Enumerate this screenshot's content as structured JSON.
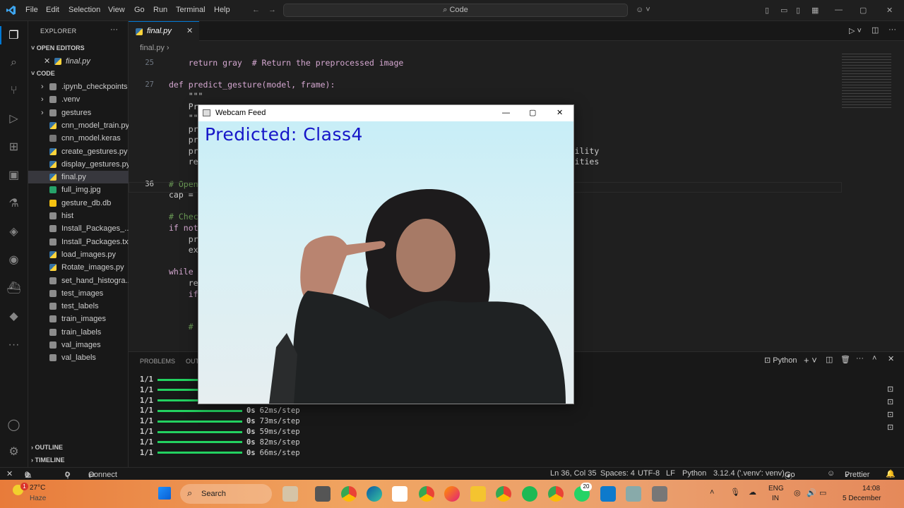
{
  "titlebar": {
    "menu": [
      "File",
      "Edit",
      "Selection",
      "View",
      "Go",
      "Run",
      "Terminal",
      "Help"
    ],
    "search": "Code"
  },
  "sidebar": {
    "title": "EXPLORER",
    "open_editors": "OPEN EDITORS",
    "open_file": "final.py",
    "folder": "CODE",
    "files": [
      ".ipynb_checkpoints",
      ".venv",
      "gestures",
      "cnn_model_train.py",
      "cnn_model.keras",
      "create_gestures.py",
      "display_gestures.py",
      "final.py",
      "full_img.jpg",
      "gesture_db.db",
      "hist",
      "Install_Packages_...",
      "Install_Packages.txt",
      "load_images.py",
      "Rotate_images.py",
      "set_hand_histogra...",
      "test_images",
      "test_labels",
      "train_images",
      "train_labels",
      "val_images",
      "val_labels"
    ],
    "outline": "OUTLINE",
    "timeline": "TIMELINE"
  },
  "editor": {
    "tab": "final.py",
    "breadcrumb": "final.py",
    "lines": [
      {
        "n": "25",
        "t": "    return gray  # Return the preprocessed image"
      },
      {
        "n": "",
        "t": ""
      },
      {
        "n": "27",
        "t": "def predict_gesture(model, frame):"
      },
      {
        "n": "",
        "t": "    \"\"\""
      },
      {
        "n": "",
        "t": "    Pre"
      },
      {
        "n": "",
        "t": "    \"\"\""
      },
      {
        "n": "",
        "t": "    pre                                                                put size"
      },
      {
        "n": "",
        "t": "    pre"
      },
      {
        "n": "",
        "t": "    pre                                                                ghest probability"
      },
      {
        "n": "",
        "t": "    ret                                                                ion probabilities"
      },
      {
        "n": "",
        "t": ""
      },
      {
        "n": "36",
        "t": "# Open"
      },
      {
        "n": "",
        "t": "cap = c                                                                  t webcam)"
      },
      {
        "n": "",
        "t": ""
      },
      {
        "n": "",
        "t": "# Check"
      },
      {
        "n": "",
        "t": "if not"
      },
      {
        "n": "",
        "t": "    pri"
      },
      {
        "n": "",
        "t": "    exi"
      },
      {
        "n": "",
        "t": ""
      },
      {
        "n": "",
        "t": "while"
      },
      {
        "n": "",
        "t": "    ret"
      },
      {
        "n": "",
        "t": "    if"
      },
      {
        "n": "",
        "t": ""
      },
      {
        "n": "",
        "t": ""
      },
      {
        "n": "",
        "t": "    # C"
      }
    ]
  },
  "panel": {
    "tabs": [
      "PROBLEMS",
      "OUT"
    ],
    "shell": "Python",
    "output": [
      {
        "a": "1/1",
        "b": "",
        "c": ""
      },
      {
        "a": "1/1",
        "b": "",
        "c": ""
      },
      {
        "a": "1/1",
        "b": "",
        "c": ""
      },
      {
        "a": "1/1",
        "b": "0s",
        "c": "62ms/step"
      },
      {
        "a": "1/1",
        "b": "0s",
        "c": "73ms/step"
      },
      {
        "a": "1/1",
        "b": "0s",
        "c": "59ms/step"
      },
      {
        "a": "1/1",
        "b": "0s",
        "c": "82ms/step"
      },
      {
        "a": "1/1",
        "b": "0s",
        "c": "66ms/step"
      }
    ]
  },
  "webcam": {
    "title": "Webcam Feed",
    "prediction": "Predicted: Class4"
  },
  "statusbar": {
    "errors": "0",
    "warnings": "0",
    "ports": "0",
    "connect": "Connect",
    "position": "Ln 36, Col 35",
    "spaces": "Spaces: 4",
    "encoding": "UTF-8",
    "eol": "LF",
    "language": "Python",
    "interpreter": "3.12.4 ('.venv': venv)",
    "golive": "Go Live",
    "prettier": "Prettier"
  },
  "taskbar": {
    "temp": "27°C",
    "weather": "Haze",
    "search": "Search",
    "lang1": "ENG",
    "lang2": "IN",
    "time": "14:08",
    "date": "5 December",
    "badge": "20",
    "notif": "1"
  }
}
